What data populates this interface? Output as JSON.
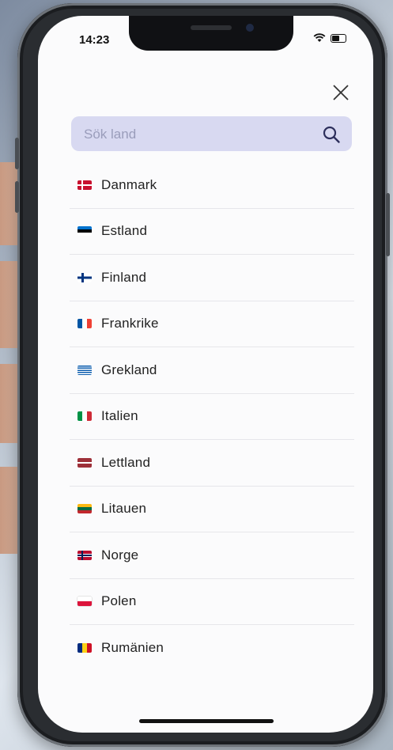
{
  "status_bar": {
    "time": "14:23"
  },
  "search": {
    "placeholder": "Sök land",
    "value": ""
  },
  "countries": [
    {
      "label": "Danmark",
      "flag": "denmark-flag-icon",
      "colors": [
        "#c8102e",
        "#ffffff"
      ]
    },
    {
      "label": "Estland",
      "flag": "estonia-flag-icon",
      "colors": [
        "#0072ce",
        "#000000",
        "#ffffff"
      ]
    },
    {
      "label": "Finland",
      "flag": "finland-flag-icon",
      "colors": [
        "#ffffff",
        "#003580"
      ]
    },
    {
      "label": "Frankrike",
      "flag": "france-flag-icon",
      "colors": [
        "#0055a4",
        "#ffffff",
        "#ef4135"
      ]
    },
    {
      "label": "Grekland",
      "flag": "greece-flag-icon",
      "colors": [
        "#0d5eaf",
        "#ffffff"
      ]
    },
    {
      "label": "Italien",
      "flag": "italy-flag-icon",
      "colors": [
        "#009246",
        "#ffffff",
        "#ce2b37"
      ]
    },
    {
      "label": "Lettland",
      "flag": "latvia-flag-icon",
      "colors": [
        "#9e3039",
        "#ffffff"
      ]
    },
    {
      "label": "Litauen",
      "flag": "lithuania-flag-icon",
      "colors": [
        "#fdb913",
        "#006a44",
        "#c1272d"
      ]
    },
    {
      "label": "Norge",
      "flag": "norway-flag-icon",
      "colors": [
        "#ba0c2f",
        "#ffffff",
        "#00205b"
      ]
    },
    {
      "label": "Polen",
      "flag": "poland-flag-icon",
      "colors": [
        "#ffffff",
        "#dc143c"
      ]
    },
    {
      "label": "Rumänien",
      "flag": "romania-flag-icon",
      "colors": [
        "#002b7f",
        "#fcd116",
        "#ce1126"
      ]
    }
  ]
}
